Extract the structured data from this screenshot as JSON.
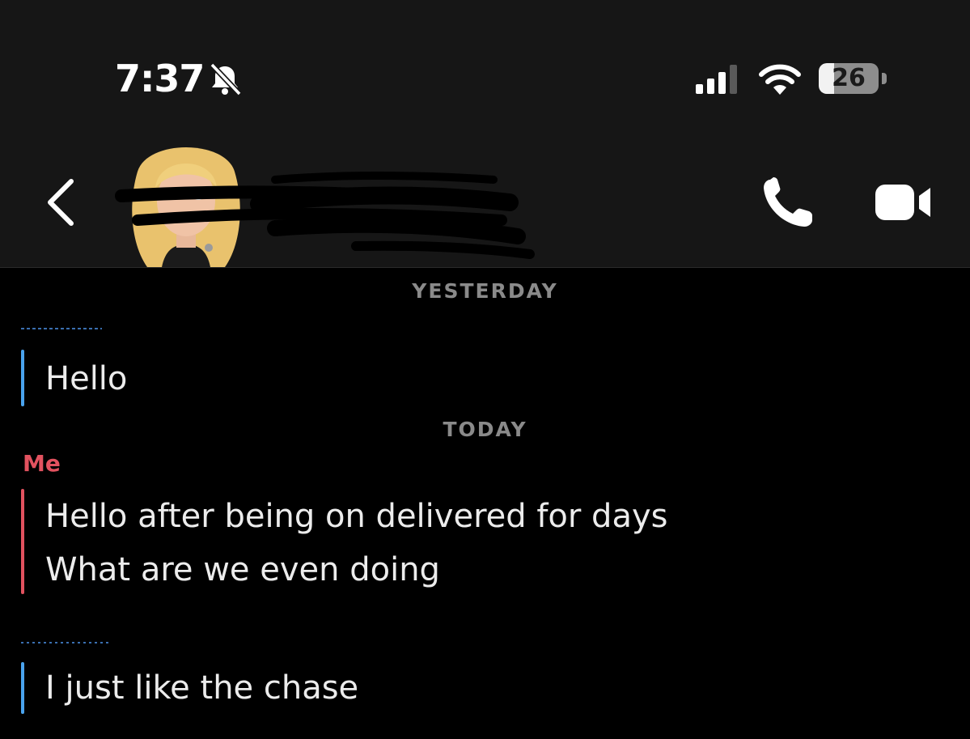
{
  "status_bar": {
    "time": "7:37",
    "battery_level": "26",
    "battery_fraction": 0.26,
    "icons": [
      "bell-slash-icon",
      "cellular-signal-icon",
      "wifi-icon",
      "battery-icon"
    ]
  },
  "header": {
    "back_icon": "chevron-left-icon",
    "call_icon": "phone-icon",
    "video_icon": "video-camera-icon"
  },
  "chat": {
    "sections": [
      {
        "date_label": "YESTERDAY"
      },
      {
        "date_label": "TODAY"
      }
    ],
    "messages": [
      {
        "sender": "",
        "lines": [
          "Hello"
        ]
      },
      {
        "sender": "Me",
        "lines": [
          "Hello after being on delivered for days",
          "What are we even doing"
        ]
      },
      {
        "sender": "",
        "lines": [
          "I just like the chase"
        ]
      }
    ]
  },
  "colors": {
    "me_accent": "#e2525f",
    "friend_accent": "#4aa3ee",
    "header_bg": "#161616",
    "chat_bg": "#000000"
  }
}
